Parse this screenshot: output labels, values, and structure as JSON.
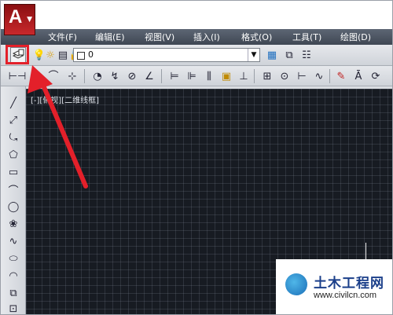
{
  "app": {
    "logo_letter": "A"
  },
  "menu": [
    {
      "id": "file",
      "label": "文件(F)"
    },
    {
      "id": "edit",
      "label": "编辑(E)"
    },
    {
      "id": "view",
      "label": "视图(V)"
    },
    {
      "id": "insert",
      "label": "插入(I)"
    },
    {
      "id": "format",
      "label": "格式(O)"
    },
    {
      "id": "tools",
      "label": "工具(T)"
    },
    {
      "id": "draw",
      "label": "绘图(D)"
    }
  ],
  "layers_toolbar": {
    "current_layer": "0"
  },
  "canvas": {
    "viewport_label": "[-][俯视][二维线框]"
  },
  "watermark": {
    "title": "土木工程网",
    "url": "www.civilcn.com"
  },
  "colors": {
    "highlight": "#e3202a",
    "canvas_bg": "#171b22",
    "menubar": "#4a525e",
    "app_button": "#c8282b"
  },
  "icons": {
    "layer_properties": "layer-properties-icon",
    "draw_tools": [
      "line",
      "construction-line",
      "polyline",
      "polygon",
      "rectangle",
      "arc",
      "circle",
      "revision-cloud",
      "spline",
      "ellipse",
      "ellipse-arc",
      "insert-block",
      "make-block"
    ]
  }
}
